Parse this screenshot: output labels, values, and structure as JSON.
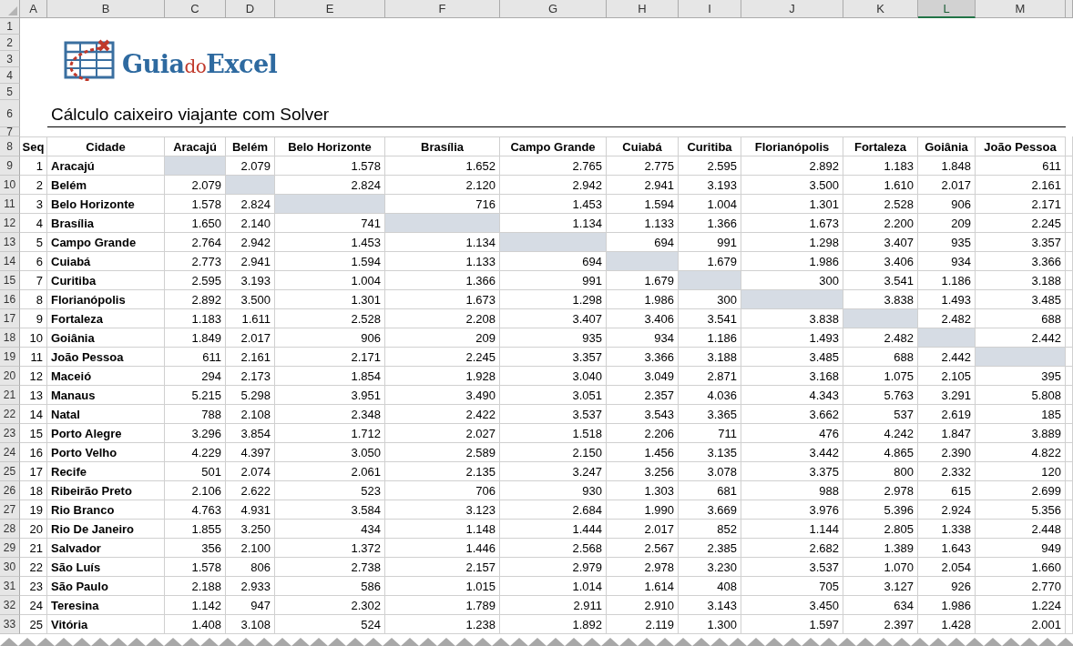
{
  "sheet": {
    "column_headers": [
      {
        "label": "A",
        "selected": false
      },
      {
        "label": "B",
        "selected": false
      },
      {
        "label": "C",
        "selected": false
      },
      {
        "label": "D",
        "selected": false
      },
      {
        "label": "E",
        "selected": false
      },
      {
        "label": "F",
        "selected": false
      },
      {
        "label": "G",
        "selected": false
      },
      {
        "label": "H",
        "selected": false
      },
      {
        "label": "I",
        "selected": false
      },
      {
        "label": "J",
        "selected": false
      },
      {
        "label": "K",
        "selected": false
      },
      {
        "label": "L",
        "selected": true
      },
      {
        "label": "M",
        "selected": false
      }
    ],
    "row_headers": [
      "1",
      "2",
      "3",
      "4",
      "5",
      "6",
      "7",
      "8",
      "9",
      "10",
      "11",
      "12",
      "13",
      "14",
      "15",
      "16",
      "17",
      "18",
      "19",
      "20",
      "21",
      "22",
      "23",
      "24",
      "25",
      "26",
      "27",
      "28",
      "29",
      "30",
      "31",
      "32",
      "33"
    ]
  },
  "logo": {
    "words": [
      {
        "text": "Guia",
        "kind": "main"
      },
      {
        "text": "do",
        "kind": "accent"
      },
      {
        "text": "Excel",
        "kind": "main"
      }
    ]
  },
  "title": "Cálculo caixeiro viajante com Solver",
  "table": {
    "columns": [
      "Seq",
      "Cidade",
      "Aracajú",
      "Belém",
      "Belo Horizonte",
      "Brasília",
      "Campo Grande",
      "Cuiabá",
      "Curitiba",
      "Florianópolis",
      "Fortaleza",
      "Goiânia",
      "João Pessoa"
    ],
    "rows": [
      {
        "seq": "1",
        "city": "Aracajú",
        "distances": [
          {
            "kind": "shaded"
          },
          "2.079",
          "1.578",
          "1.652",
          "2.765",
          "2.775",
          "2.595",
          "2.892",
          "1.183",
          "1.848",
          "611"
        ]
      },
      {
        "seq": "2",
        "city": "Belém",
        "distances": [
          "2.079",
          {
            "kind": "shaded"
          },
          "2.824",
          "2.120",
          "2.942",
          "2.941",
          "3.193",
          "3.500",
          "1.610",
          "2.017",
          "2.161"
        ]
      },
      {
        "seq": "3",
        "city": "Belo Horizonte",
        "distances": [
          "1.578",
          "2.824",
          {
            "kind": "shaded"
          },
          "716",
          "1.453",
          "1.594",
          "1.004",
          "1.301",
          "2.528",
          "906",
          "2.171"
        ]
      },
      {
        "seq": "4",
        "city": "Brasília",
        "distances": [
          "1.650",
          "2.140",
          "741",
          {
            "kind": "shaded"
          },
          "1.134",
          "1.133",
          "1.366",
          "1.673",
          "2.200",
          "209",
          "2.245"
        ]
      },
      {
        "seq": "5",
        "city": "Campo Grande",
        "distances": [
          "2.764",
          "2.942",
          "1.453",
          "1.134",
          {
            "kind": "shaded"
          },
          "694",
          "991",
          "1.298",
          "3.407",
          "935",
          "3.357"
        ]
      },
      {
        "seq": "6",
        "city": "Cuiabá",
        "distances": [
          "2.773",
          "2.941",
          "1.594",
          "1.133",
          "694",
          {
            "kind": "shaded"
          },
          "1.679",
          "1.986",
          "3.406",
          "934",
          "3.366"
        ]
      },
      {
        "seq": "7",
        "city": "Curitiba",
        "distances": [
          "2.595",
          "3.193",
          "1.004",
          "1.366",
          "991",
          "1.679",
          {
            "kind": "shaded"
          },
          "300",
          "3.541",
          "1.186",
          "3.188"
        ]
      },
      {
        "seq": "8",
        "city": "Florianópolis",
        "distances": [
          "2.892",
          "3.500",
          "1.301",
          "1.673",
          "1.298",
          "1.986",
          "300",
          {
            "kind": "shaded"
          },
          "3.838",
          "1.493",
          "3.485"
        ]
      },
      {
        "seq": "9",
        "city": "Fortaleza",
        "distances": [
          "1.183",
          "1.611",
          "2.528",
          "2.208",
          "3.407",
          "3.406",
          "3.541",
          "3.838",
          {
            "kind": "shaded"
          },
          "2.482",
          "688"
        ]
      },
      {
        "seq": "10",
        "city": "Goiânia",
        "distances": [
          "1.849",
          "2.017",
          "906",
          "209",
          "935",
          "934",
          "1.186",
          "1.493",
          "2.482",
          {
            "kind": "shaded"
          },
          "2.442"
        ]
      },
      {
        "seq": "11",
        "city": "João Pessoa",
        "distances": [
          "611",
          "2.161",
          "2.171",
          "2.245",
          "3.357",
          "3.366",
          "3.188",
          "3.485",
          "688",
          "2.442",
          {
            "kind": "shaded"
          }
        ]
      },
      {
        "seq": "12",
        "city": "Maceió",
        "distances": [
          "294",
          "2.173",
          "1.854",
          "1.928",
          "3.040",
          "3.049",
          "2.871",
          "3.168",
          "1.075",
          "2.105",
          "395"
        ]
      },
      {
        "seq": "13",
        "city": "Manaus",
        "distances": [
          "5.215",
          "5.298",
          "3.951",
          "3.490",
          "3.051",
          "2.357",
          "4.036",
          "4.343",
          "5.763",
          "3.291",
          "5.808"
        ]
      },
      {
        "seq": "14",
        "city": "Natal",
        "distances": [
          "788",
          "2.108",
          "2.348",
          "2.422",
          "3.537",
          "3.543",
          "3.365",
          "3.662",
          "537",
          "2.619",
          "185"
        ]
      },
      {
        "seq": "15",
        "city": "Porto Alegre",
        "distances": [
          "3.296",
          "3.854",
          "1.712",
          "2.027",
          "1.518",
          "2.206",
          "711",
          "476",
          "4.242",
          "1.847",
          "3.889"
        ]
      },
      {
        "seq": "16",
        "city": "Porto Velho",
        "distances": [
          "4.229",
          "4.397",
          "3.050",
          "2.589",
          "2.150",
          "1.456",
          "3.135",
          "3.442",
          "4.865",
          "2.390",
          "4.822"
        ]
      },
      {
        "seq": "17",
        "city": "Recife",
        "distances": [
          "501",
          "2.074",
          "2.061",
          "2.135",
          "3.247",
          "3.256",
          "3.078",
          "3.375",
          "800",
          "2.332",
          "120"
        ]
      },
      {
        "seq": "18",
        "city": "Ribeirão Preto",
        "distances": [
          "2.106",
          "2.622",
          "523",
          "706",
          "930",
          "1.303",
          "681",
          "988",
          "2.978",
          "615",
          "2.699"
        ]
      },
      {
        "seq": "19",
        "city": "Rio Branco",
        "distances": [
          "4.763",
          "4.931",
          "3.584",
          "3.123",
          "2.684",
          "1.990",
          "3.669",
          "3.976",
          "5.396",
          "2.924",
          "5.356"
        ]
      },
      {
        "seq": "20",
        "city": "Rio De Janeiro",
        "distances": [
          "1.855",
          "3.250",
          "434",
          "1.148",
          "1.444",
          "2.017",
          "852",
          "1.144",
          "2.805",
          "1.338",
          "2.448"
        ]
      },
      {
        "seq": "21",
        "city": "Salvador",
        "distances": [
          "356",
          "2.100",
          "1.372",
          "1.446",
          "2.568",
          "2.567",
          "2.385",
          "2.682",
          "1.389",
          "1.643",
          "949"
        ]
      },
      {
        "seq": "22",
        "city": "São Luís",
        "distances": [
          "1.578",
          "806",
          "2.738",
          "2.157",
          "2.979",
          "2.978",
          "3.230",
          "3.537",
          "1.070",
          "2.054",
          "1.660"
        ]
      },
      {
        "seq": "23",
        "city": "São Paulo",
        "distances": [
          "2.188",
          "2.933",
          "586",
          "1.015",
          "1.014",
          "1.614",
          "408",
          "705",
          "3.127",
          "926",
          "2.770"
        ]
      },
      {
        "seq": "24",
        "city": "Teresina",
        "distances": [
          "1.142",
          "947",
          "2.302",
          "1.789",
          "2.911",
          "2.910",
          "3.143",
          "3.450",
          "634",
          "1.986",
          "1.224"
        ]
      },
      {
        "seq": "25",
        "city": "Vitória",
        "distances": [
          "1.408",
          "3.108",
          "524",
          "1.238",
          "1.892",
          "2.119",
          "1.300",
          "1.597",
          "2.397",
          "1.428",
          "2.001"
        ]
      }
    ]
  }
}
